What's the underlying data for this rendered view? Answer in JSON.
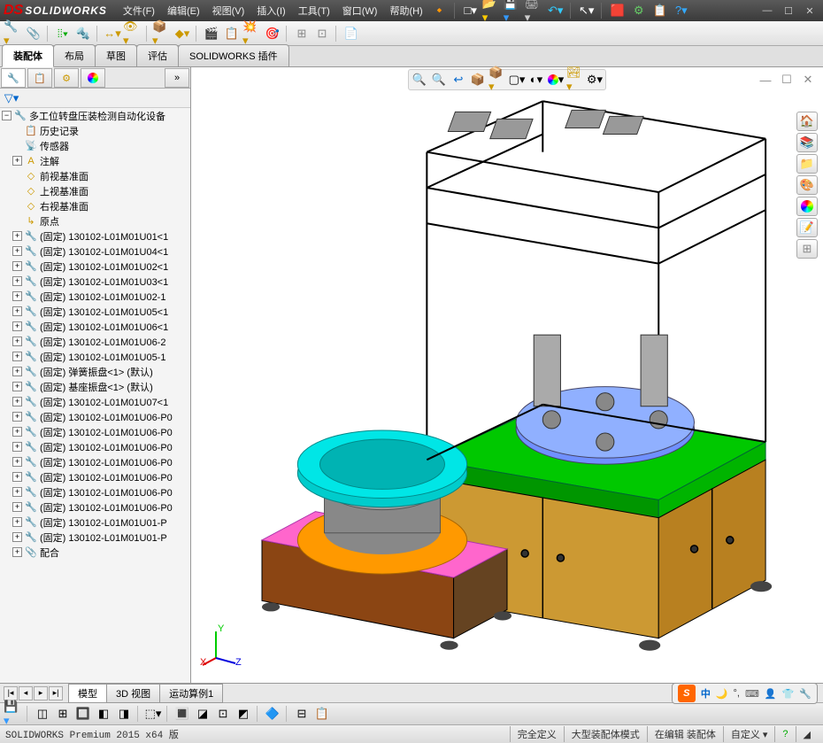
{
  "app": {
    "name": "SOLIDWORKS"
  },
  "menu": [
    "文件(F)",
    "编辑(E)",
    "视图(V)",
    "插入(I)",
    "工具(T)",
    "窗口(W)",
    "帮助(H)"
  ],
  "tabs": [
    "装配体",
    "布局",
    "草图",
    "评估",
    "SOLIDWORKS 插件"
  ],
  "tree_root": "多工位转盘压装检测自动化设备",
  "tree_header": [
    {
      "icon": "📋",
      "label": "历史记录"
    },
    {
      "icon": "📡",
      "label": "传感器"
    },
    {
      "icon": "A",
      "label": "注解",
      "yellow": true
    },
    {
      "icon": "◇",
      "label": "前视基准面"
    },
    {
      "icon": "◇",
      "label": "上视基准面"
    },
    {
      "icon": "◇",
      "label": "右视基准面"
    },
    {
      "icon": "↳",
      "label": "原点"
    }
  ],
  "tree_items": [
    "(固定) 130102-L01M01U01<1",
    "(固定) 130102-L01M01U04<1",
    "(固定) 130102-L01M01U02<1",
    "(固定) 130102-L01M01U03<1",
    "(固定) 130102-L01M01U02-1",
    "(固定) 130102-L01M01U05<1",
    "(固定) 130102-L01M01U06<1",
    "(固定) 130102-L01M01U06-2",
    "(固定) 130102-L01M01U05-1",
    "(固定) 弹簧振盘<1> (默认)",
    "(固定) 基座振盘<1> (默认)",
    "(固定) 130102-L01M01U07<1",
    "(固定) 130102-L01M01U06-P0",
    "(固定) 130102-L01M01U06-P0",
    "(固定) 130102-L01M01U06-P0",
    "(固定) 130102-L01M01U06-P0",
    "(固定) 130102-L01M01U06-P0",
    "(固定) 130102-L01M01U06-P0",
    "(固定) 130102-L01M01U06-P0",
    "(固定) 130102-L01M01U01-P",
    "(固定) 130102-L01M01U01-P"
  ],
  "tree_mates": "配合",
  "bottom_tabs": [
    "模型",
    "3D 视图",
    "运动算例1"
  ],
  "status": {
    "left": "SOLIDWORKS Premium 2015 x64 版",
    "def": "完全定义",
    "mode": "大型装配体模式",
    "edit": "在编辑 装配体",
    "custom": "自定义"
  },
  "ime": {
    "s": "S",
    "cn": "中"
  }
}
